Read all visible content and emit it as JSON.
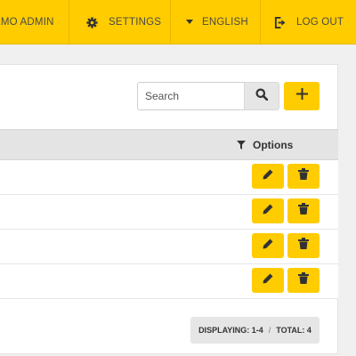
{
  "nav": {
    "user_label": "EMO ADMIN",
    "settings_label": "SETTINGS",
    "language_label": "ENGLISH",
    "logout_label": "LOG OUT"
  },
  "search": {
    "placeholder": "Search",
    "value": ""
  },
  "table": {
    "options_header": "Options",
    "rows": [
      {
        "name": ""
      },
      {
        "name": ""
      },
      {
        "name": ""
      },
      {
        "name": ""
      }
    ]
  },
  "pager": {
    "displaying": "DISPLAYING: 1-4",
    "separator": "/",
    "total": "TOTAL: 4"
  },
  "colors": {
    "accent": "#ffcc00",
    "header_bg": "#e4e4e4",
    "page_bg": "#f0f0f0"
  },
  "icons": {
    "settings": "gear-icon",
    "language": "caret-down-icon",
    "logout": "logout-icon",
    "search": "search-icon",
    "add": "plus-icon",
    "filter": "filter-icon",
    "edit": "pencil-icon",
    "delete": "trash-icon"
  }
}
